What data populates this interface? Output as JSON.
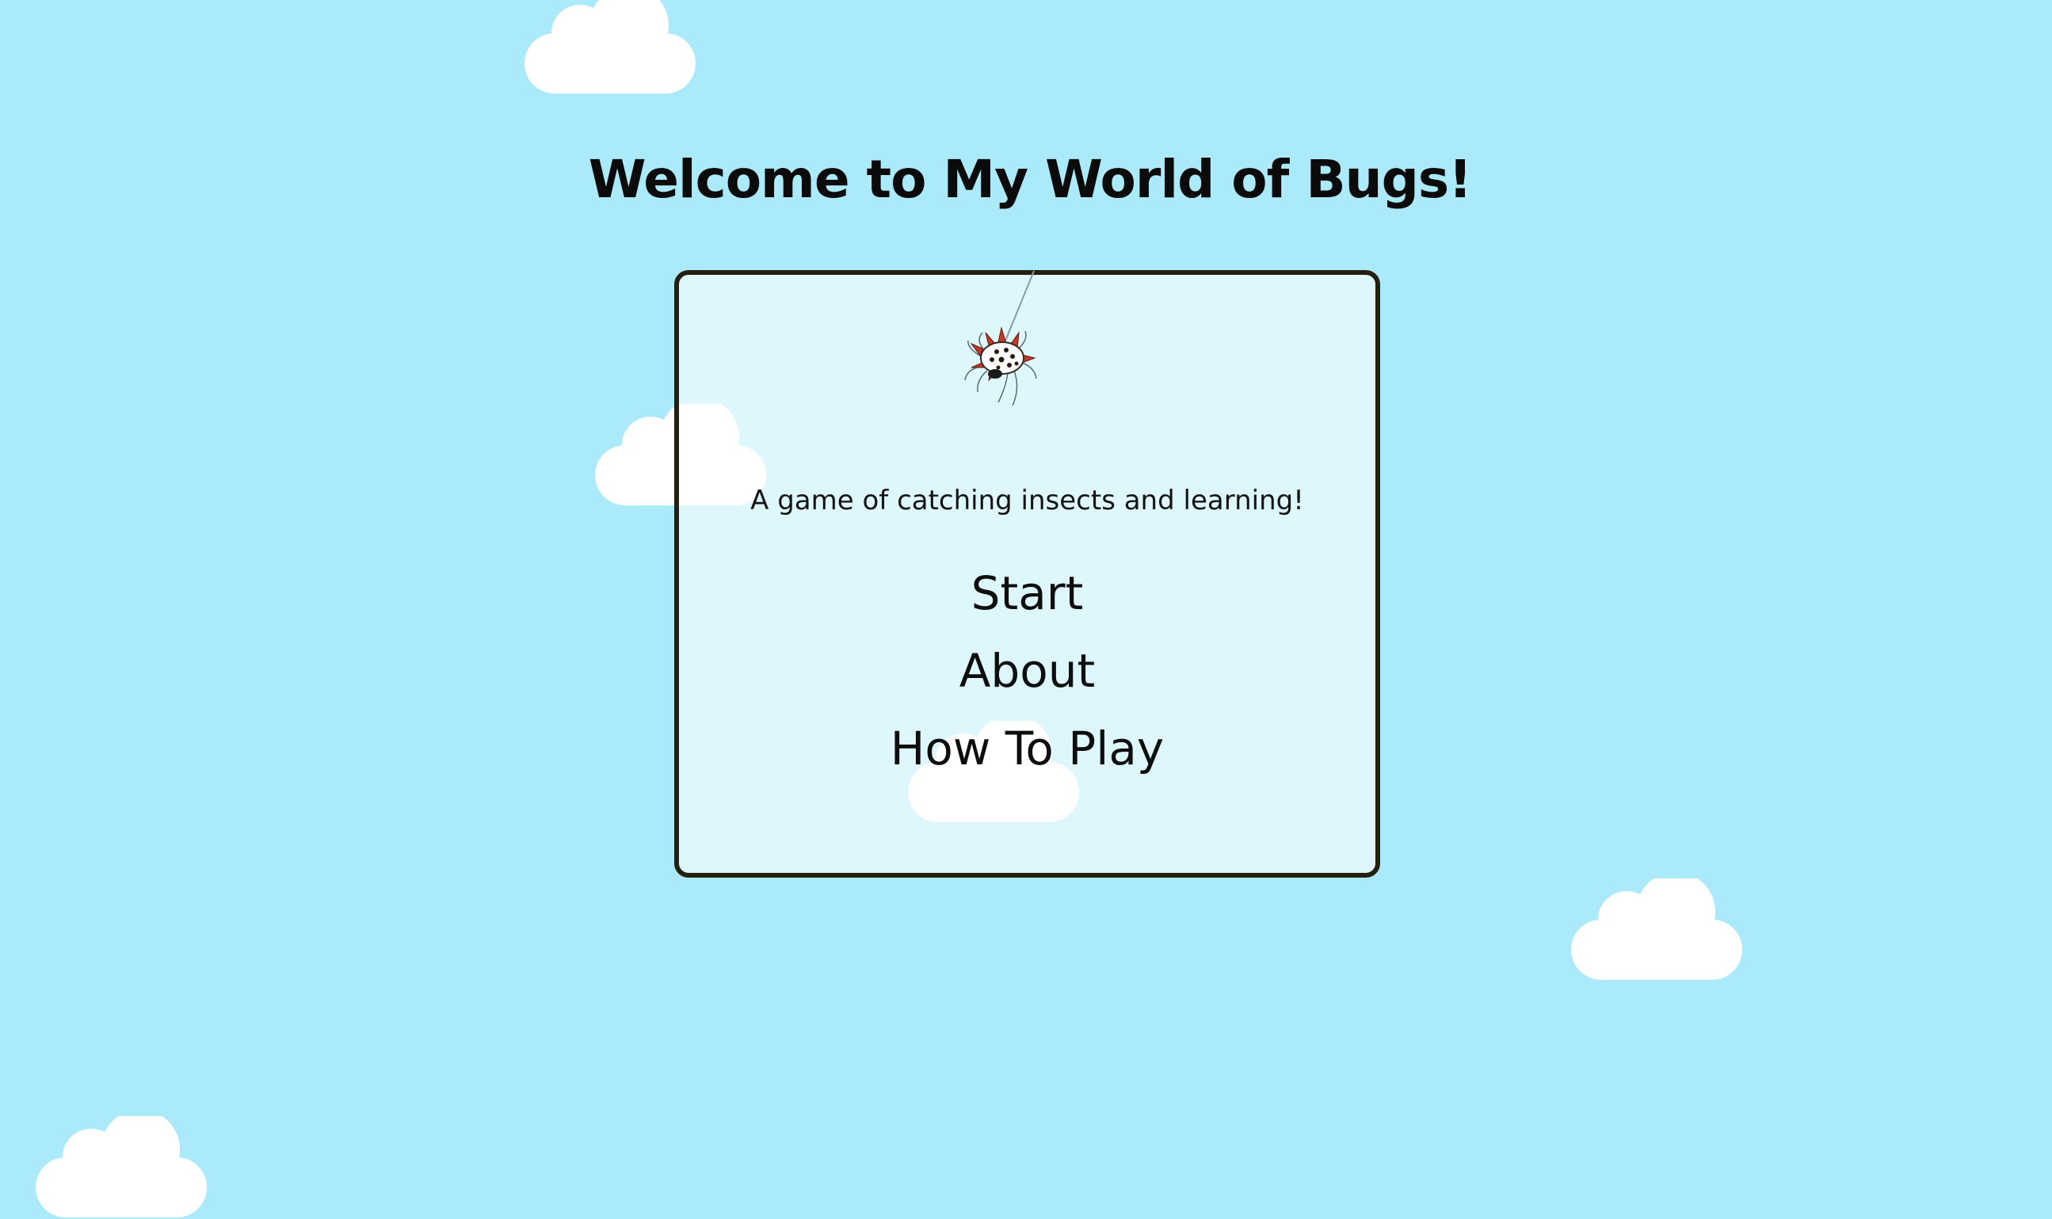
{
  "title": "Welcome to My World of Bugs!",
  "subtitle": "A game of catching insects and learning!",
  "menu": {
    "items": [
      {
        "label": "Start"
      },
      {
        "label": "About"
      },
      {
        "label": "How To Play"
      }
    ]
  },
  "colors": {
    "sky": "#abeafb",
    "panel_border": "#24200f",
    "cloud": "#ffffff",
    "spider_body": "#ffffff",
    "spider_spikes": "#c53a26"
  },
  "icons": {
    "clouds": "cloud-icon",
    "bug": "spider-icon"
  }
}
